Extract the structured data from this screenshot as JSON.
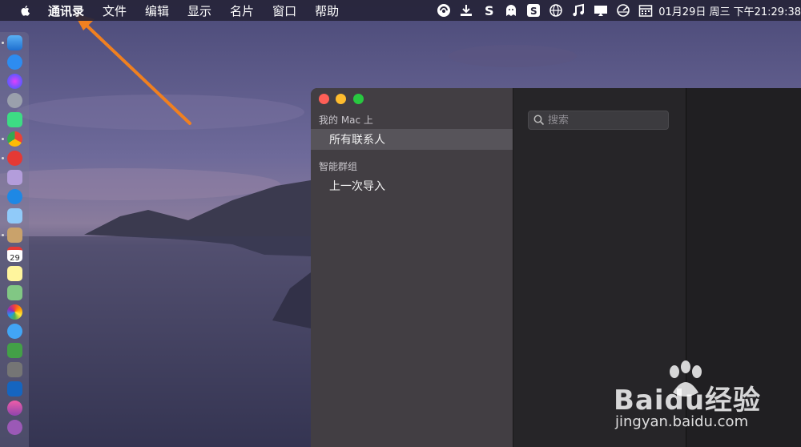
{
  "menubar": {
    "app_menu": "通讯录",
    "items": [
      "文件",
      "编辑",
      "显示",
      "名片",
      "窗口",
      "帮助"
    ],
    "clock": "01月29日 周三 下午21:29:38",
    "status_icons": [
      "vpn-icon",
      "download-icon",
      "s-app-icon",
      "qq-ghost-icon",
      "sogou-icon",
      "globe-icon",
      "music-note-icon",
      "display-icon",
      "speedometer-icon",
      "calendar-icon"
    ]
  },
  "dock": {
    "icons": [
      "finder-icon",
      "app-store-icon",
      "siri-icon",
      "launchpad-icon",
      "android-icon",
      "chrome-icon",
      "red-app-icon",
      "disk-icon",
      "safari-icon",
      "preview-icon",
      "contacts-icon",
      "calendar-icon",
      "notes-icon",
      "maps-icon",
      "photos-icon",
      "messages-icon",
      "facetime-icon",
      "system-preferences-icon",
      "keynote-icon",
      "itunes-icon",
      "podcasts-icon"
    ],
    "calendar_day": "29"
  },
  "window": {
    "sidebar": {
      "section_mac": "我的 Mac 上",
      "all_contacts": "所有联系人",
      "section_smart": "智能群组",
      "last_import": "上一次导入"
    },
    "search": {
      "placeholder": "搜索"
    }
  },
  "watermark": {
    "brand": "Baidu经验",
    "url": "jingyan.baidu.com"
  },
  "colors": {
    "accent_arrow": "#f08020",
    "close": "#ff5f57",
    "minimize": "#febc2e",
    "zoom": "#28c840"
  }
}
